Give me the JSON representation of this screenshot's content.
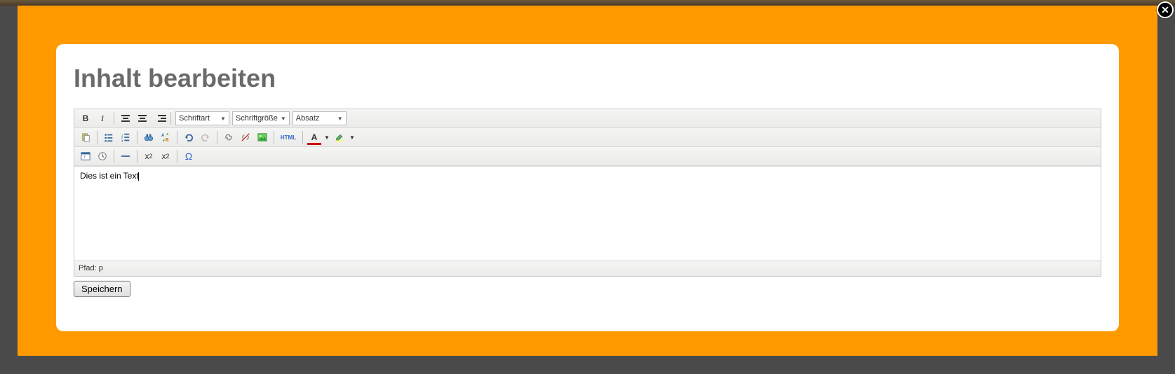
{
  "page_title": "Inhalt bearbeiten",
  "toolbar": {
    "font_family_label": "Schriftart",
    "font_size_label": "Schriftgröße",
    "block_format_label": "Absatz",
    "html_label": "HTML"
  },
  "editor": {
    "content": "Dies ist ein Text",
    "path_prefix": "Pfad: ",
    "path_value": "p"
  },
  "buttons": {
    "save": "Speichern"
  },
  "icons": {
    "bold": "B",
    "italic": "I",
    "text_color": "A",
    "subscript": "x",
    "subscript_sub": "2",
    "superscript": "x",
    "superscript_sup": "2",
    "omega": "Ω",
    "close": "✕"
  }
}
